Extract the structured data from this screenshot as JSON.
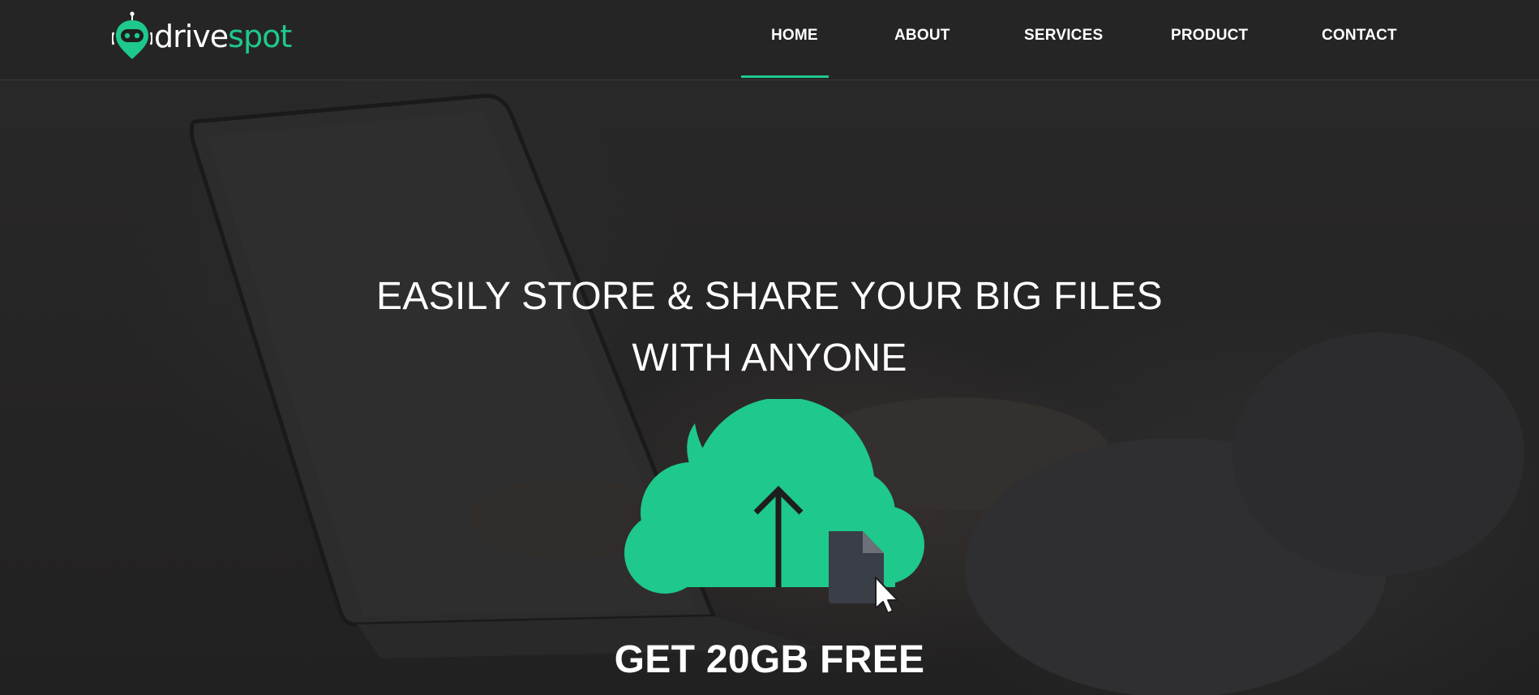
{
  "brand": {
    "name_part1": "drive",
    "name_part2": "spot",
    "accent_color": "#1ec98b"
  },
  "nav": {
    "items": [
      {
        "label": "HOME",
        "active": true
      },
      {
        "label": "ABOUT",
        "active": false
      },
      {
        "label": "SERVICES",
        "active": false
      },
      {
        "label": "PRODUCT",
        "active": false
      },
      {
        "label": "CONTACT",
        "active": false
      }
    ]
  },
  "hero": {
    "headline_line1": "EASILY STORE & SHARE YOUR BIG FILES",
    "headline_line2": "WITH ANYONE",
    "illustration": "cloud-upload-icon",
    "cta": "GET 20GB FREE"
  },
  "colors": {
    "background": "#242323",
    "cloud": "#1ec98b",
    "file": "#3a3f47"
  }
}
